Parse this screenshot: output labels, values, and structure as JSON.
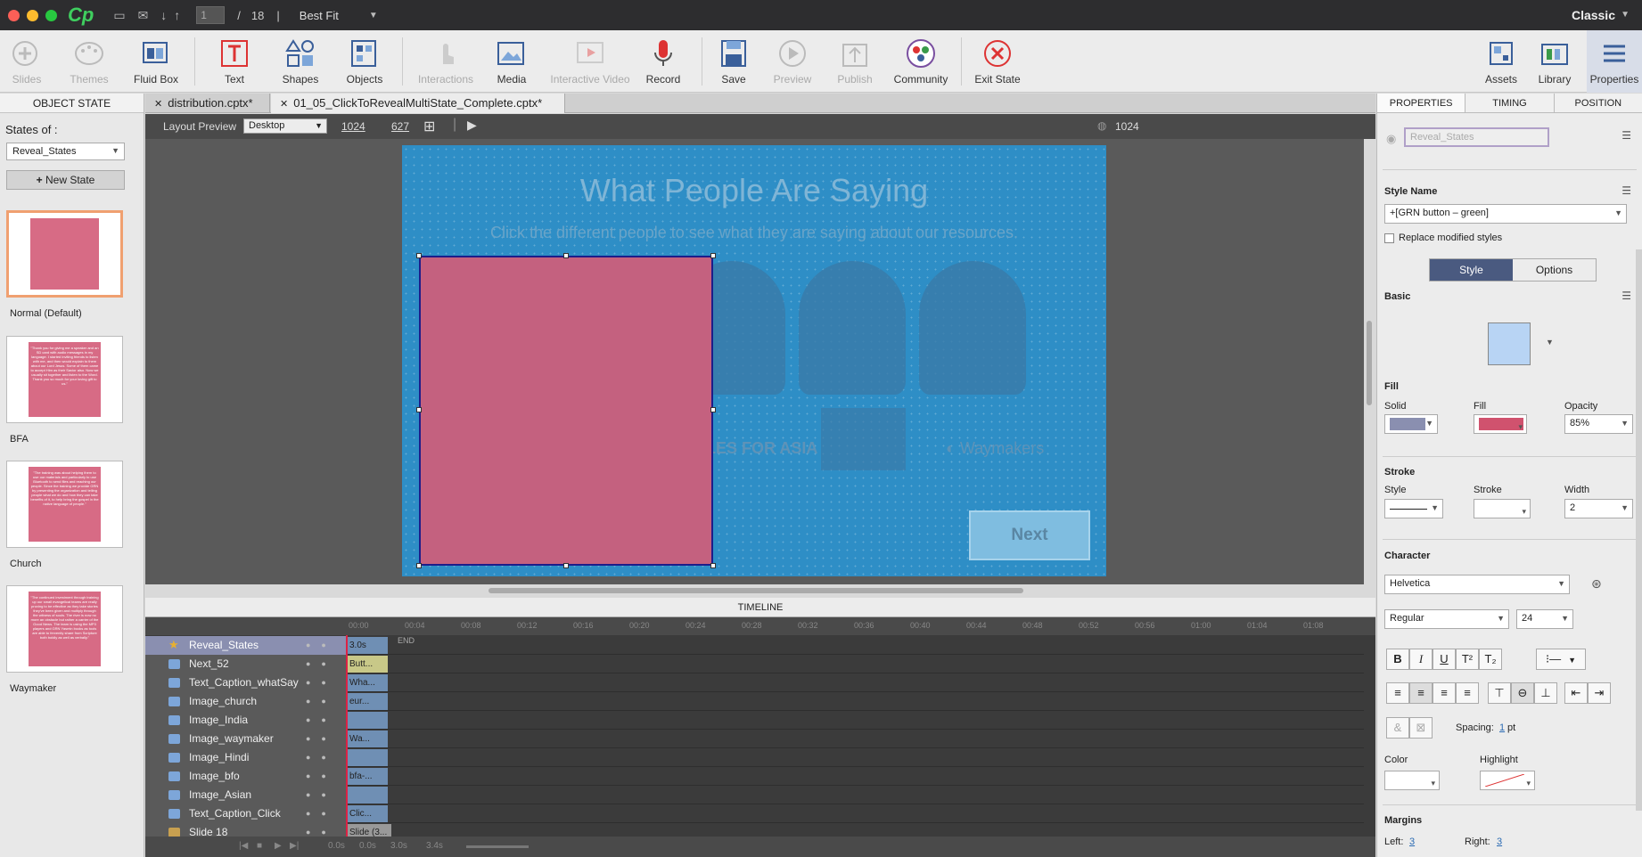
{
  "titlebar": {
    "page_current": "1",
    "page_separator": "/",
    "page_total": "18",
    "zoom": "Best Fit",
    "mode": "Classic"
  },
  "toolbar": {
    "slides": "Slides",
    "themes": "Themes",
    "fluid_box": "Fluid Box",
    "text": "Text",
    "shapes": "Shapes",
    "objects": "Objects",
    "interactions": "Interactions",
    "media": "Media",
    "interactive_video": "Interactive Video",
    "record": "Record",
    "save": "Save",
    "preview": "Preview",
    "publish": "Publish",
    "community": "Community",
    "exit_state": "Exit State",
    "assets": "Assets",
    "library": "Library",
    "properties": "Properties"
  },
  "left_panel": {
    "header": "OBJECT STATE",
    "states_of_label": "States of :",
    "states_select": "Reveal_States",
    "new_state": "New State",
    "states": [
      {
        "label": "Normal (Default)",
        "text": ""
      },
      {
        "label": "BFA",
        "text": "\"Thank you for giving me a speaker and an SD card with audio messages in my language. I started inviting friends to listen with me, and then would explain to them about our Lord Jesus. Some of them came to accept Him as their Savior also. Now we usually sit together and listen to the Word. Thank you so much for your loving gift to us.\""
      },
      {
        "label": "Church",
        "text": "\"The training was about helping them to use our materials and particularly to use Bluetooth to send files and reaching our people. Since the training we provide GRN by presenting the organization and telling people what we do and how they can take benefits of it, to help bring the gospel in the native language of people.\""
      },
      {
        "label": "Waymaker",
        "text": "\"The continued investment through training up our small evangelical teams are really proving to be effective as they take stories they've been given and multiply through the witness of souls. The river is now no more an obstacle but rather a carrier of the Good News. The team is using the MP3 players and GRN Yasmin books as tools are able to fervently share from Scripture both boldly as well as verbally.\""
      }
    ]
  },
  "doc_tabs": [
    {
      "label": "distribution.cptx*"
    },
    {
      "label": "01_05_ClickToRevealMultiState_Complete.cptx*"
    }
  ],
  "layout_preview": {
    "label": "Layout Preview",
    "device": "Desktop",
    "width": "1024",
    "height": "627",
    "ruler_width": "1024"
  },
  "slide": {
    "title": "What People Are Saying",
    "subtitle": "Click the different people to see what they are saying about our resources.",
    "logo_asia": "BIBLES FOR ASIA",
    "logo_waymakers": "Waymakers",
    "next_button": "Next"
  },
  "timeline": {
    "header": "TIMELINE",
    "end_label": "END",
    "ticks": [
      "00:00",
      "00:04",
      "00:08",
      "00:12",
      "00:16",
      "00:20",
      "00:24",
      "00:28",
      "00:32",
      "00:36",
      "00:40",
      "00:44",
      "00:48",
      "00:52",
      "00:56",
      "01:00",
      "01:04",
      "01:08"
    ],
    "rows": [
      {
        "name": "Reveal_States",
        "bar": "3.0s",
        "selected": true
      },
      {
        "name": "Next_52",
        "bar": "Butt...",
        "selected": false
      },
      {
        "name": "Text_Caption_whatSay",
        "bar": "Wha...",
        "selected": false
      },
      {
        "name": "Image_church",
        "bar": "eur...",
        "selected": false
      },
      {
        "name": "Image_India",
        "bar": "",
        "selected": false
      },
      {
        "name": "Image_waymaker",
        "bar": "Wa...",
        "selected": false
      },
      {
        "name": "Image_Hindi",
        "bar": "",
        "selected": false
      },
      {
        "name": "Image_bfo",
        "bar": "bfa-...",
        "selected": false
      },
      {
        "name": "Image_Asian",
        "bar": "",
        "selected": false
      },
      {
        "name": "Text_Caption_Click",
        "bar": "Clic...",
        "selected": false
      },
      {
        "name": "Slide 18",
        "bar": "Slide (3...",
        "selected": false
      }
    ],
    "footer": {
      "t1": "0.0s",
      "t2": "0.0s",
      "t3": "3.0s",
      "t4": "3.4s"
    }
  },
  "right_panel": {
    "tabs": [
      "PROPERTIES",
      "TIMING",
      "POSITION"
    ],
    "object_name": "Reveal_States",
    "style_name_label": "Style Name",
    "style_name_value": "+[GRN button – green]",
    "replace_label": "Replace modified styles",
    "seg_style": "Style",
    "seg_options": "Options",
    "basic_label": "Basic",
    "fill_label": "Fill",
    "solid_label": "Solid",
    "fill_sub_label": "Fill",
    "opacity_label": "Opacity",
    "opacity_value": "85%",
    "stroke_label": "Stroke",
    "stroke_style_label": "Style",
    "stroke_stroke_label": "Stroke",
    "width_label": "Width",
    "width_value": "2",
    "character_label": "Character",
    "font_value": "Helvetica",
    "font_style": "Regular",
    "font_size": "24",
    "spacing_label": "Spacing:",
    "spacing_value": "1",
    "spacing_unit": "pt",
    "color_label": "Color",
    "highlight_label": "Highlight",
    "margins_label": "Margins",
    "left_label": "Left:",
    "left_value": "3",
    "right_label": "Right:",
    "right_value": "3"
  },
  "colors": {
    "slide_bg": "#2e8ec6",
    "state_fill": "#c4617f",
    "accent": "#4a5a80"
  }
}
